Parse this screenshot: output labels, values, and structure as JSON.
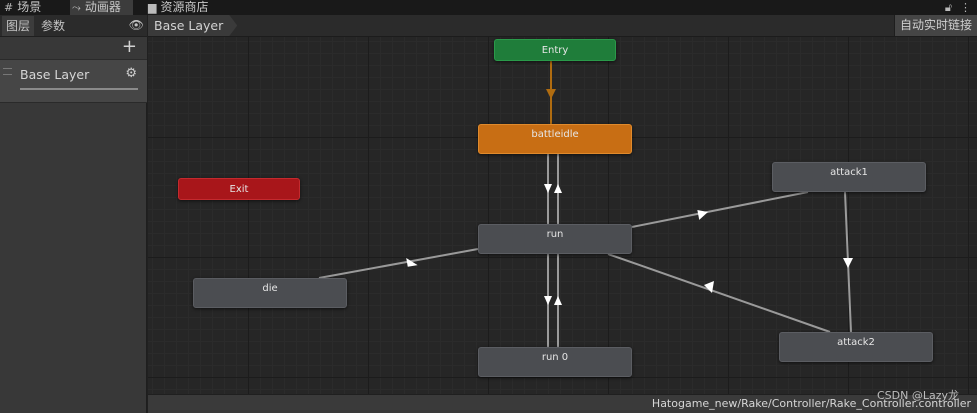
{
  "tabs": {
    "scene": {
      "icon": "grid-icon",
      "label": "场景"
    },
    "animator": {
      "icon": "animator-icon",
      "label": "动画器"
    },
    "asset_store": {
      "icon": "store-icon",
      "label": "资源商店"
    }
  },
  "left_panel": {
    "tab_layers": "图层",
    "tab_parameters": "参数",
    "layers": [
      {
        "name": "Base Layer"
      }
    ]
  },
  "graph": {
    "breadcrumb": "Base Layer",
    "auto_live_link": "自动实时链接",
    "states": {
      "entry": "Entry",
      "exit": "Exit",
      "battleidle": "battleidle",
      "run": "run",
      "run0": "run 0",
      "die": "die",
      "attack1": "attack1",
      "attack2": "attack2"
    }
  },
  "status_bar": {
    "path": "Hatogame_new/Rake/Controller/Rake_Controller.controller"
  },
  "watermark": "CSDN @Lazy龙",
  "colors": {
    "entry": "#1f7d3a",
    "exit": "#a8161a",
    "default_state": "#c86e14",
    "state": "#4b4d51",
    "transition": "#9a9a9a",
    "default_transition": "#b06c10"
  }
}
